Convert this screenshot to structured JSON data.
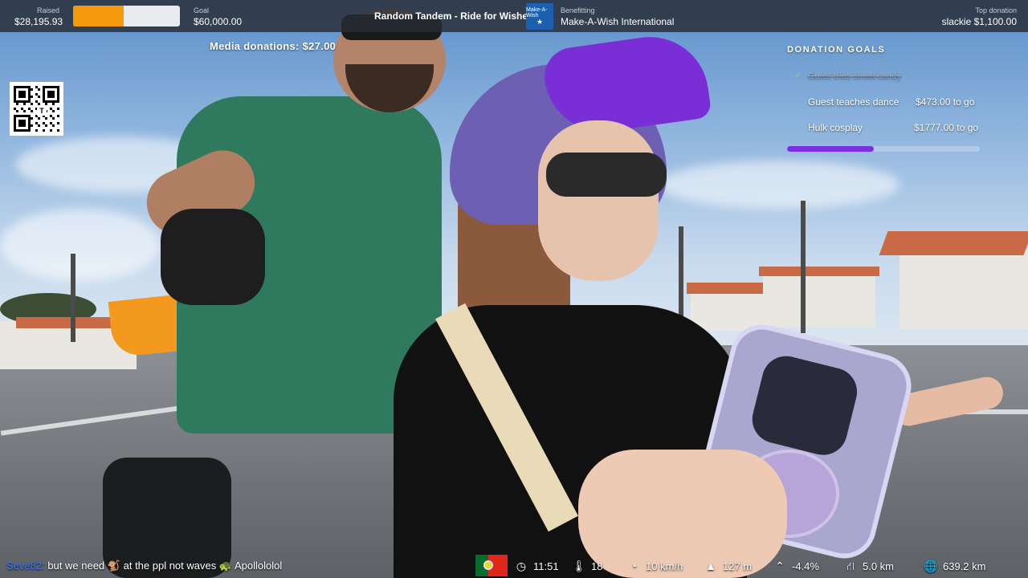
{
  "topbar": {
    "raised_label": "Raised",
    "raised_value": "$28,195.93",
    "progress_fraction": 0.47,
    "goal_label": "Goal",
    "goal_value": "$60,000.00",
    "stream_title": "Random Tandem - Ride for Wishes",
    "benefitting_label": "Benefitting",
    "benefitting_value": "Make-A-Wish International",
    "logo_text": "Make-A-Wish",
    "top_donation_label": "Top donation",
    "top_donation_value": "slackie $1,100.00"
  },
  "media_donations": "Media donations: $27.00",
  "qr": {
    "center_letter": "T"
  },
  "donation_goals": {
    "title": "DONATION GOALS",
    "completed_goal": "Guest tries street candy",
    "goals": [
      {
        "name": "Guest teaches dance",
        "amount": "$473.00 to go"
      },
      {
        "name": "Hulk cosplay",
        "amount": "$1777.00 to go"
      }
    ],
    "progress_fraction": 0.45,
    "accent": "#7a2fe0"
  },
  "chat": {
    "user": "Seve82:",
    "message_part1": "but we need",
    "message_part2": "at the ppl not waves",
    "message_part3": "Apollololol"
  },
  "stats": {
    "country_flag": "portugal-flag",
    "time": "11:51",
    "temperature": "18",
    "speed": "10 km/h",
    "altitude": "127 m",
    "grade": "-4.4%",
    "distance_remaining": "5.0 km",
    "total_distance": "639.2 km"
  }
}
